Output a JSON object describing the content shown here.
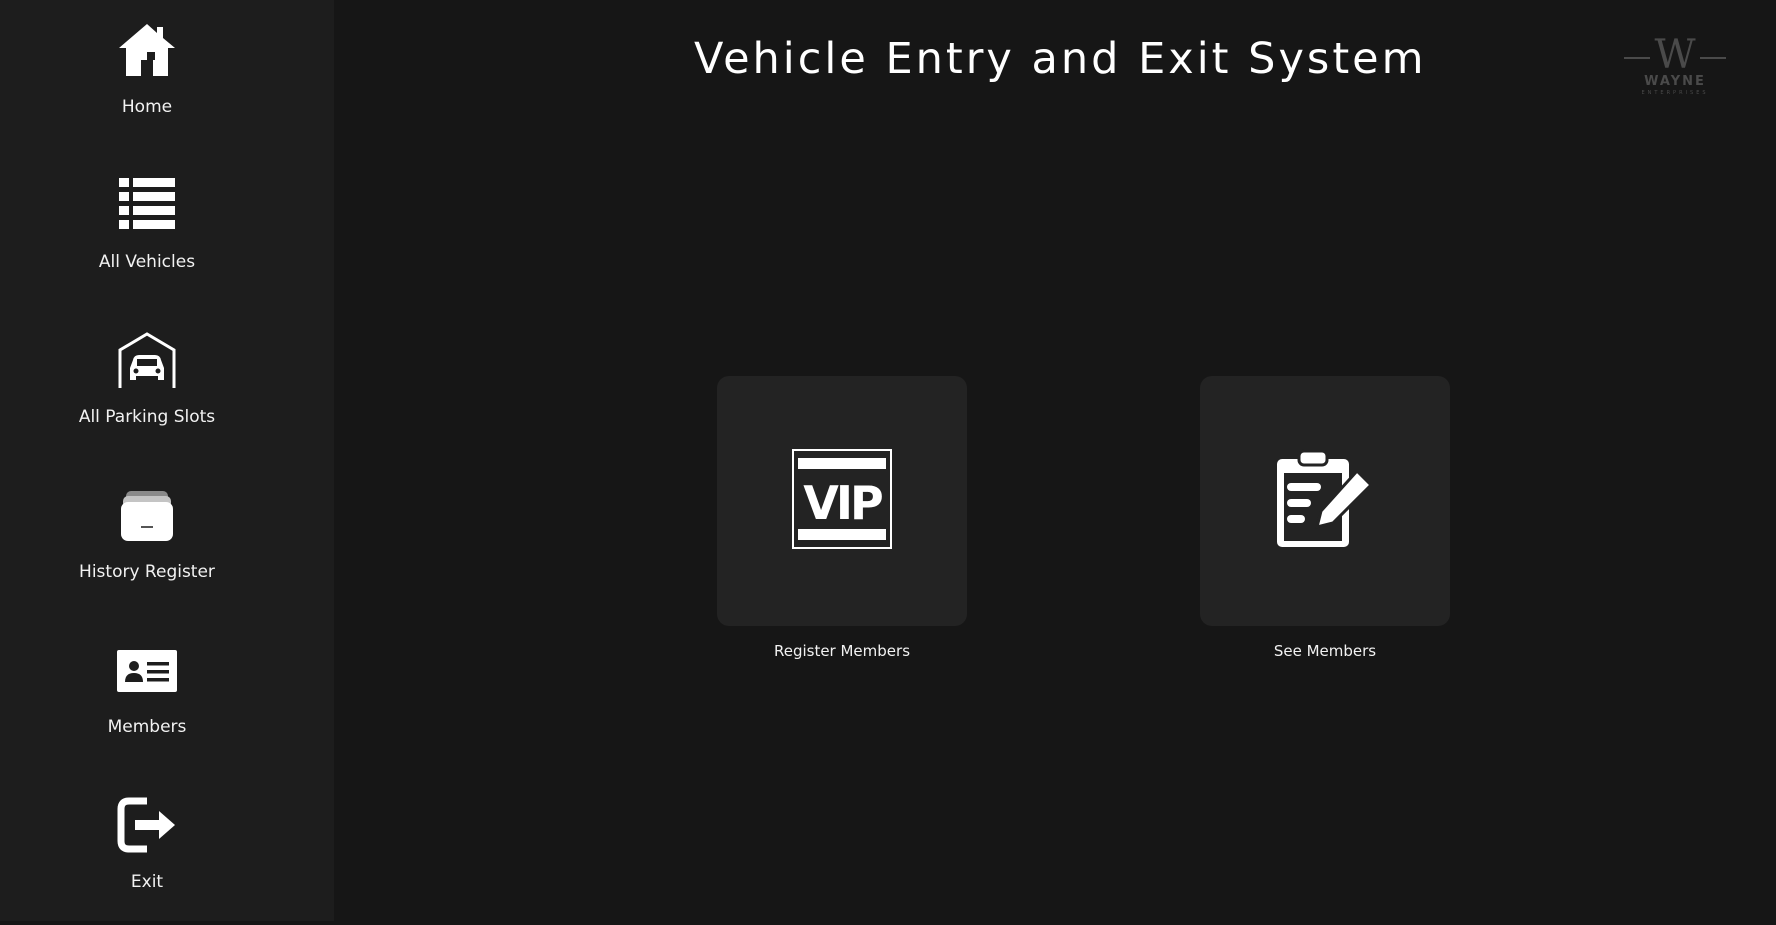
{
  "app": {
    "title": "Vehicle Entry and Exit System"
  },
  "logo": {
    "icon": "wayne-enterprises-logo",
    "mark": "W",
    "text": "WAYNE",
    "subtext": "ENTERPRISES"
  },
  "sidebar": {
    "items": [
      {
        "label": "Home",
        "icon": "home-icon"
      },
      {
        "label": "All Vehicles",
        "icon": "list-icon"
      },
      {
        "label": "All Parking Slots",
        "icon": "garage-car-icon"
      },
      {
        "label": "History Register",
        "icon": "archive-icon"
      },
      {
        "label": "Members",
        "icon": "id-card-icon"
      },
      {
        "label": "Exit",
        "icon": "exit-icon"
      }
    ]
  },
  "main": {
    "tiles": [
      {
        "label": "Register Members",
        "icon": "vip-icon"
      },
      {
        "label": "See Members",
        "icon": "clipboard-edit-icon"
      }
    ]
  },
  "colors": {
    "background": "#161616",
    "sidebar": "#1d1d1d",
    "tile": "#232323",
    "text": "#ffffff",
    "logo": "#4a4a4a"
  }
}
